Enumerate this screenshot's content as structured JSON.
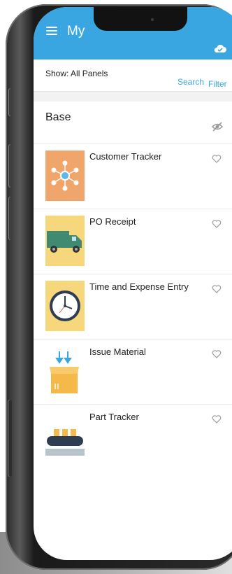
{
  "app": {
    "title": "My",
    "show_label": "Show: All Panels",
    "search_label": "Search",
    "filter_label": "Filter",
    "section_title": "Base",
    "accent_color": "#3aa6e1"
  },
  "panels": [
    {
      "label": "Customer Tracker",
      "icon": "network-icon"
    },
    {
      "label": "PO Receipt",
      "icon": "truck-icon"
    },
    {
      "label": "Time and Expense Entry",
      "icon": "clock-icon"
    },
    {
      "label": "Issue Material",
      "icon": "box-icon"
    },
    {
      "label": "Part Tracker",
      "icon": "conveyor-icon"
    }
  ]
}
